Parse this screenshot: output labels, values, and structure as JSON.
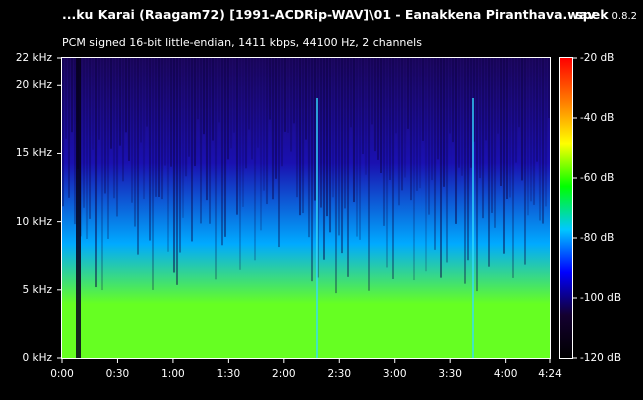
{
  "header": {
    "file_title": "...ku Karai (Raagam72) [1991-ACDRip-WAV]\\01 - Eanakkena Piranthava.wav",
    "app_name": "spek",
    "app_version": "0.8.2",
    "format_info": "PCM signed 16-bit little-endian, 1411 kbps, 44100 Hz, 2 channels"
  },
  "frequency_axis": {
    "unit_labels": [
      "0 kHz",
      "5 kHz",
      "10 kHz",
      "15 kHz",
      "20 kHz",
      "22 kHz"
    ],
    "values_khz": [
      0,
      5,
      10,
      15,
      20,
      22
    ],
    "max_khz": 22
  },
  "time_axis": {
    "labels": [
      "0:00",
      "0:30",
      "1:00",
      "1:30",
      "2:00",
      "2:30",
      "3:00",
      "3:30",
      "4:00",
      "4:24"
    ],
    "values_s": [
      0,
      30,
      60,
      90,
      120,
      150,
      180,
      210,
      240,
      264
    ],
    "duration_s": 264
  },
  "db_scale": {
    "labels": [
      "-20 dB",
      "-40 dB",
      "-60 dB",
      "-80 dB",
      "-100 dB",
      "-120 dB"
    ],
    "values_db": [
      -20,
      -40,
      -60,
      -80,
      -100,
      -120
    ],
    "max_db": -20,
    "min_db": -120,
    "gradient": [
      "#ff0000",
      "#ff7a00",
      "#ffff00",
      "#00ff00",
      "#00c8ff",
      "#0000ff",
      "#140030",
      "#000000"
    ]
  },
  "colors": {
    "background": "#000000",
    "text": "#ffffff",
    "spectrogram_low": "#66ff22",
    "spectrogram_mid": "#00aaff",
    "spectrogram_high": "#1a10b0",
    "spectrogram_top": "#1d0760"
  }
}
